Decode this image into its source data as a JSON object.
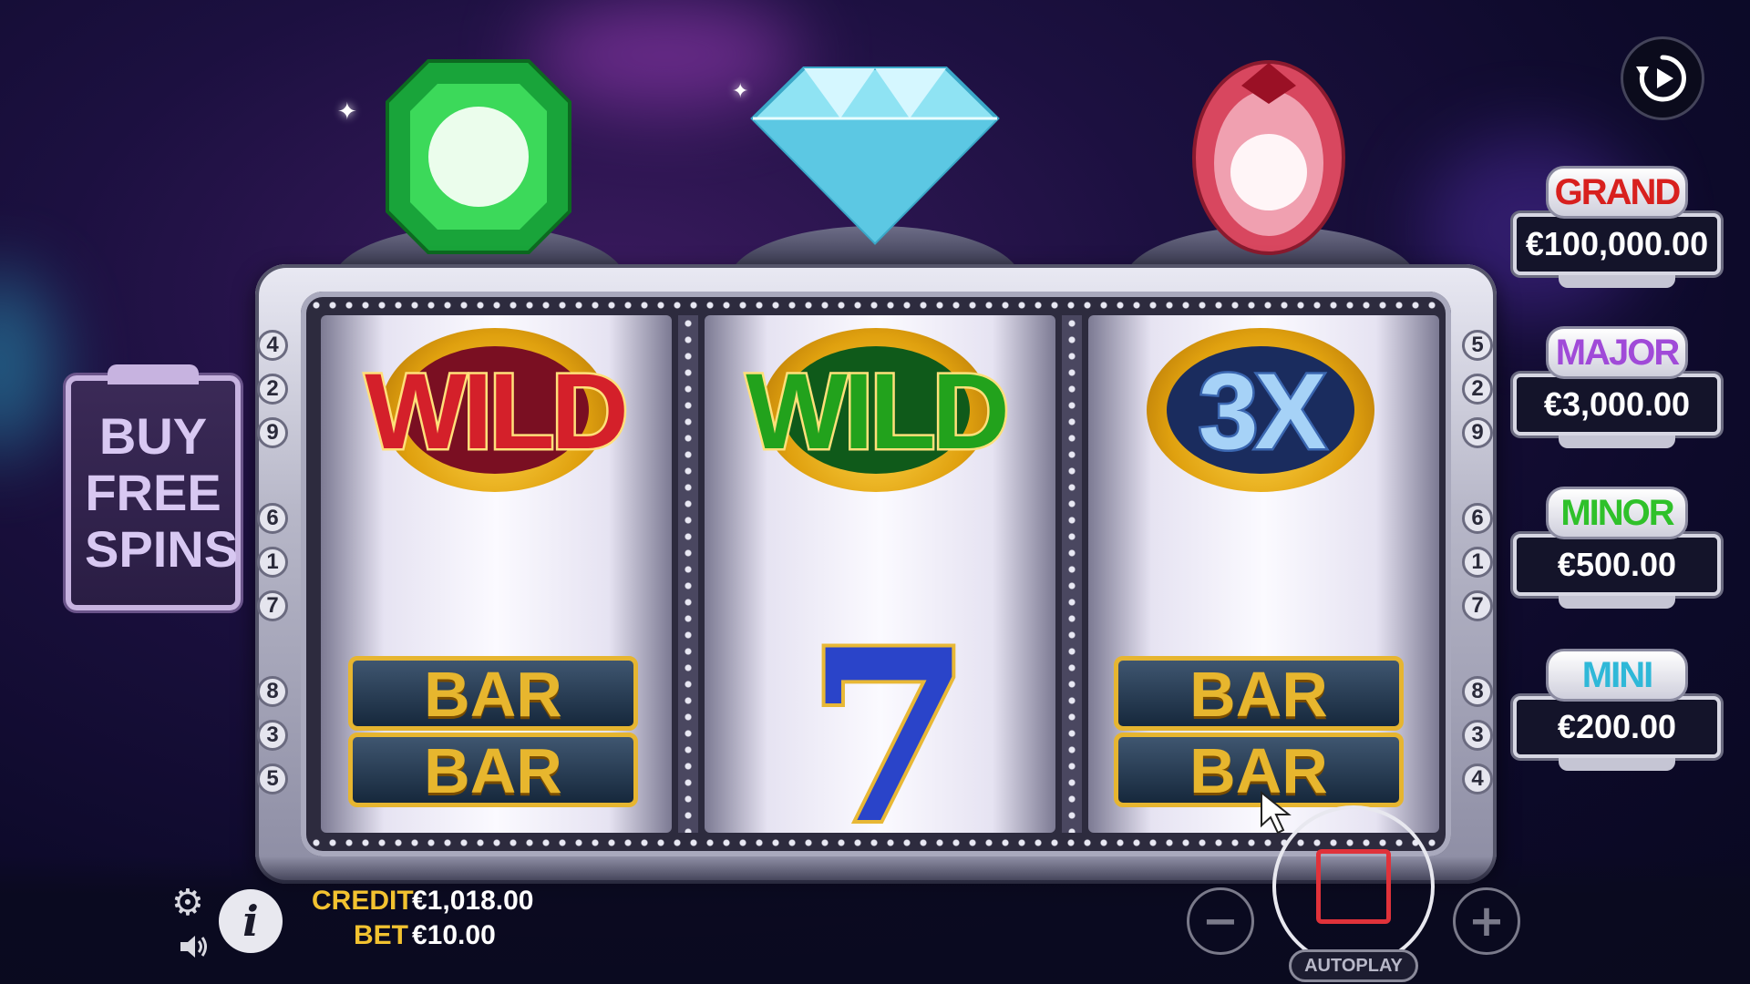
{
  "jackpots": [
    {
      "name": "GRAND",
      "value": "€100,000.00",
      "color": "#d8201e"
    },
    {
      "name": "MAJOR",
      "value": "€3,000.00",
      "color": "#a04ad8"
    },
    {
      "name": "MINOR",
      "value": "€500.00",
      "color": "#2fc12a"
    },
    {
      "name": "MINI",
      "value": "€200.00",
      "color": "#2fb8d8"
    }
  ],
  "buy_free_spins": {
    "label": "BUY FREE SPINS"
  },
  "reels": {
    "top_gems": [
      "emerald",
      "diamond",
      "ruby"
    ],
    "row_top": [
      {
        "type": "wild",
        "label": "WILD",
        "color": "#d4202a"
      },
      {
        "type": "wild",
        "label": "WILD",
        "color": "#22a21c"
      },
      {
        "type": "multiplier",
        "label": "3X",
        "color": "#7fb8ee"
      }
    ],
    "row_bottom": [
      {
        "type": "double-bar",
        "label": "BAR"
      },
      {
        "type": "seven",
        "label": "7"
      },
      {
        "type": "double-bar",
        "label": "BAR"
      }
    ]
  },
  "paylines": {
    "left": [
      "4",
      "2",
      "9",
      "6",
      "1",
      "7",
      "8",
      "3",
      "5"
    ],
    "right": [
      "5",
      "2",
      "9",
      "6",
      "1",
      "7",
      "8",
      "3",
      "4"
    ]
  },
  "credit": {
    "label": "CREDIT",
    "value": "€1,018.00"
  },
  "bet": {
    "label": "BET",
    "value": "€10.00"
  },
  "controls": {
    "autoplay_label": "AUTOPLAY",
    "minus": "−",
    "plus": "+",
    "info": "i"
  },
  "colors": {
    "accent_gold": "#f2c230",
    "stop_red": "#e0323a"
  }
}
